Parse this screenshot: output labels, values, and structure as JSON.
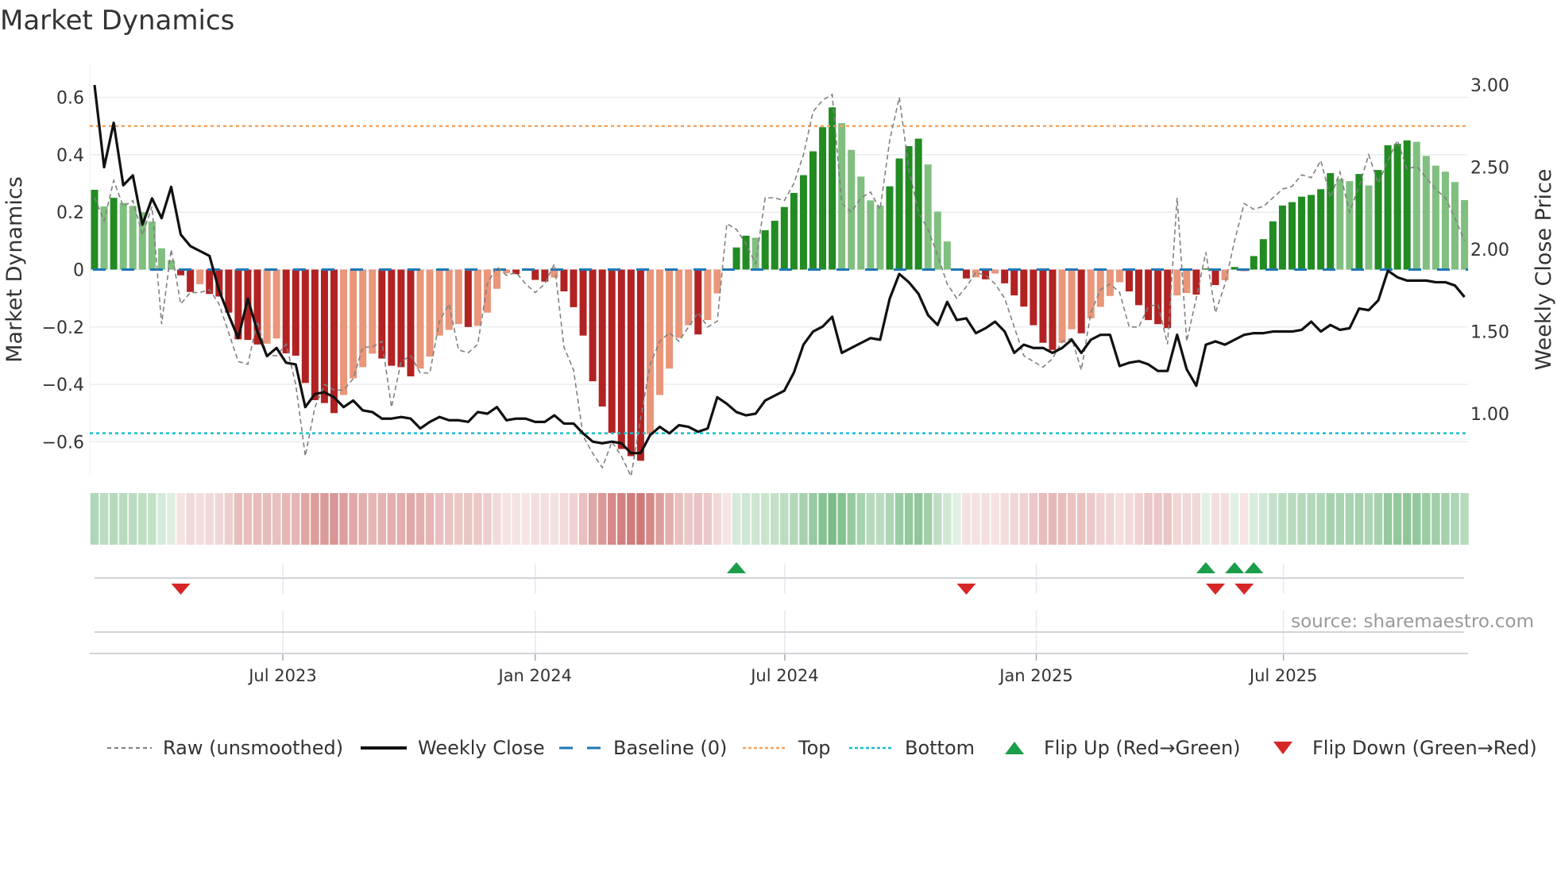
{
  "title": "Market Dynamics",
  "source": "source: sharemaestro.com",
  "colors": {
    "up_strong": "#228b22",
    "up_weak": "#80bf80",
    "down_strong": "#b22222",
    "down_weak": "#e9967a",
    "heat_green": "#3a9a4a",
    "heat_red": "#c0504d",
    "raw": "#808080",
    "close": "#111111",
    "baseline": "#1f77b4",
    "top": "#f4a460",
    "bottom": "#17becf",
    "flip_up": "#1a9e4a",
    "flip_down": "#d62728"
  },
  "chart_data": {
    "type": "bar+line",
    "title": "Market Dynamics",
    "interval": "weekly",
    "ylabel_left": "Market Dynamics",
    "ylabel_right": "Weekly Close Price",
    "ylim_left": [
      -0.715,
      0.715
    ],
    "ylim_right": [
      0.628,
      3.126
    ],
    "yticks_left": [
      {
        "v": 0.6,
        "label": "0.6"
      },
      {
        "v": 0.4,
        "label": "0.4"
      },
      {
        "v": 0.2,
        "label": "0.2"
      },
      {
        "v": 0,
        "label": "0"
      },
      {
        "v": -0.2,
        "label": "−0.2"
      },
      {
        "v": -0.4,
        "label": "−0.4"
      },
      {
        "v": -0.6,
        "label": "−0.6"
      }
    ],
    "yticks_right": [
      {
        "v": 3.0,
        "label": "3.00"
      },
      {
        "v": 2.5,
        "label": "2.50"
      },
      {
        "v": 2.0,
        "label": "2.00"
      },
      {
        "v": 1.5,
        "label": "1.50"
      },
      {
        "v": 1.0,
        "label": "1.00"
      }
    ],
    "xticks": [
      {
        "week": 19.65,
        "label": "Jul 2023"
      },
      {
        "week": 46.0,
        "label": "Jan 2024"
      },
      {
        "week": 72.05,
        "label": "Jul 2024"
      },
      {
        "week": 98.3,
        "label": "Jan 2025"
      },
      {
        "week": 124.1,
        "label": "Jul 2025"
      }
    ],
    "top_level": 0.5,
    "bottom_level": -0.57,
    "baseline": 0,
    "smoothed": [
      0.278,
      0.22,
      0.25,
      0.232,
      0.222,
      0.2,
      0.167,
      0.074,
      0.032,
      -0.02,
      -0.078,
      -0.051,
      -0.085,
      -0.094,
      -0.15,
      -0.243,
      -0.245,
      -0.261,
      -0.258,
      -0.24,
      -0.292,
      -0.3,
      -0.395,
      -0.455,
      -0.465,
      -0.5,
      -0.437,
      -0.379,
      -0.34,
      -0.293,
      -0.31,
      -0.335,
      -0.34,
      -0.372,
      -0.345,
      -0.303,
      -0.23,
      -0.21,
      -0.19,
      -0.2,
      -0.196,
      -0.15,
      -0.067,
      -0.013,
      -0.016,
      -0.004,
      -0.036,
      -0.042,
      -0.028,
      -0.076,
      -0.131,
      -0.23,
      -0.389,
      -0.477,
      -0.569,
      -0.625,
      -0.65,
      -0.666,
      -0.574,
      -0.437,
      -0.345,
      -0.238,
      -0.194,
      -0.226,
      -0.176,
      -0.083,
      -0.002,
      0.077,
      0.118,
      0.111,
      0.137,
      0.17,
      0.218,
      0.267,
      0.329,
      0.412,
      0.496,
      0.565,
      0.51,
      0.417,
      0.324,
      0.241,
      0.223,
      0.29,
      0.387,
      0.43,
      0.456,
      0.366,
      0.202,
      0.098,
      0.004,
      -0.031,
      -0.027,
      -0.034,
      -0.014,
      -0.048,
      -0.09,
      -0.129,
      -0.194,
      -0.255,
      -0.28,
      -0.255,
      -0.208,
      -0.222,
      -0.17,
      -0.13,
      -0.092,
      -0.044,
      -0.076,
      -0.124,
      -0.176,
      -0.19,
      -0.204,
      -0.09,
      -0.082,
      -0.087,
      0.004,
      -0.054,
      -0.037,
      0.009,
      -0.005,
      0.047,
      0.106,
      0.168,
      0.223,
      0.235,
      0.254,
      0.26,
      0.28,
      0.336,
      0.316,
      0.308,
      0.333,
      0.293,
      0.347,
      0.433,
      0.438,
      0.45,
      0.445,
      0.396,
      0.362,
      0.341,
      0.305,
      0.242
    ],
    "raw": [
      0.25,
      0.17,
      0.31,
      0.22,
      0.24,
      0.12,
      0.22,
      -0.19,
      0.07,
      -0.12,
      -0.08,
      -0.08,
      -0.07,
      -0.12,
      -0.22,
      -0.32,
      -0.33,
      -0.18,
      -0.3,
      -0.3,
      -0.26,
      -0.4,
      -0.65,
      -0.48,
      -0.4,
      -0.42,
      -0.42,
      -0.38,
      -0.27,
      -0.27,
      -0.25,
      -0.48,
      -0.32,
      -0.3,
      -0.36,
      -0.36,
      -0.18,
      -0.12,
      -0.28,
      -0.29,
      -0.26,
      -0.05,
      0.01,
      -0.02,
      -0.01,
      -0.05,
      -0.08,
      -0.05,
      0.02,
      -0.27,
      -0.35,
      -0.58,
      -0.64,
      -0.69,
      -0.6,
      -0.65,
      -0.72,
      -0.52,
      -0.33,
      -0.25,
      -0.22,
      -0.25,
      -0.2,
      -0.15,
      -0.2,
      -0.18,
      0.16,
      0.14,
      0.09,
      0.02,
      0.25,
      0.25,
      0.24,
      0.3,
      0.4,
      0.55,
      0.59,
      0.61,
      0.23,
      0.2,
      0.25,
      0.27,
      0.21,
      0.45,
      0.6,
      0.35,
      0.2,
      0.14,
      0.05,
      -0.05,
      -0.1,
      -0.06,
      -0.01,
      -0.02,
      -0.05,
      -0.1,
      -0.2,
      -0.3,
      -0.32,
      -0.34,
      -0.31,
      -0.25,
      -0.24,
      -0.35,
      -0.15,
      -0.07,
      -0.05,
      -0.08,
      -0.2,
      -0.2,
      -0.13,
      -0.12,
      -0.26,
      0.25,
      -0.25,
      -0.1,
      0.06,
      -0.15,
      -0.05,
      0.1,
      0.23,
      0.21,
      0.22,
      0.25,
      0.28,
      0.29,
      0.33,
      0.32,
      0.38,
      0.25,
      0.34,
      0.2,
      0.29,
      0.4,
      0.3,
      0.38,
      0.45,
      0.35,
      0.36,
      0.32,
      0.28,
      0.25,
      0.18,
      0.1
    ],
    "close": [
      3.0,
      2.5,
      2.77,
      2.39,
      2.45,
      2.15,
      2.31,
      2.19,
      2.38,
      2.09,
      2.02,
      1.99,
      1.96,
      1.75,
      1.6,
      1.46,
      1.7,
      1.5,
      1.35,
      1.4,
      1.31,
      1.3,
      1.04,
      1.12,
      1.13,
      1.1,
      1.04,
      1.08,
      1.02,
      1.01,
      0.97,
      0.97,
      0.98,
      0.97,
      0.91,
      0.95,
      0.98,
      0.96,
      0.96,
      0.95,
      1.01,
      1.0,
      1.04,
      0.96,
      0.97,
      0.97,
      0.95,
      0.95,
      0.99,
      0.94,
      0.94,
      0.88,
      0.83,
      0.82,
      0.83,
      0.82,
      0.76,
      0.76,
      0.87,
      0.92,
      0.88,
      0.93,
      0.92,
      0.89,
      0.91,
      1.1,
      1.06,
      1.01,
      0.99,
      1.0,
      1.08,
      1.11,
      1.14,
      1.25,
      1.42,
      1.5,
      1.53,
      1.59,
      1.37,
      1.4,
      1.43,
      1.46,
      1.45,
      1.7,
      1.85,
      1.8,
      1.73,
      1.6,
      1.54,
      1.68,
      1.57,
      1.58,
      1.49,
      1.52,
      1.56,
      1.5,
      1.37,
      1.42,
      1.4,
      1.4,
      1.37,
      1.4,
      1.45,
      1.37,
      1.45,
      1.48,
      1.48,
      1.29,
      1.31,
      1.32,
      1.3,
      1.26,
      1.26,
      1.48,
      1.27,
      1.17,
      1.42,
      1.44,
      1.42,
      1.45,
      1.48,
      1.49,
      1.49,
      1.5,
      1.5,
      1.5,
      1.51,
      1.56,
      1.5,
      1.54,
      1.51,
      1.52,
      1.64,
      1.63,
      1.69,
      1.87,
      1.83,
      1.81,
      1.81,
      1.81,
      1.8,
      1.8,
      1.78,
      1.71
    ],
    "flip_up_weeks": [
      67,
      116,
      119,
      121
    ],
    "flip_down_weeks": [
      9,
      91,
      117,
      120
    ],
    "legend": {
      "position": "bottom",
      "items": [
        {
          "key": "raw",
          "label": "Raw (unsmoothed)"
        },
        {
          "key": "close",
          "label": "Weekly Close"
        },
        {
          "key": "baseline",
          "label": "Baseline (0)"
        },
        {
          "key": "top",
          "label": "Top"
        },
        {
          "key": "bottom",
          "label": "Bottom"
        },
        {
          "key": "flip_up",
          "label": "Flip Up (Red→Green)"
        },
        {
          "key": "flip_down",
          "label": "Flip Down (Green→Red)"
        }
      ]
    }
  }
}
